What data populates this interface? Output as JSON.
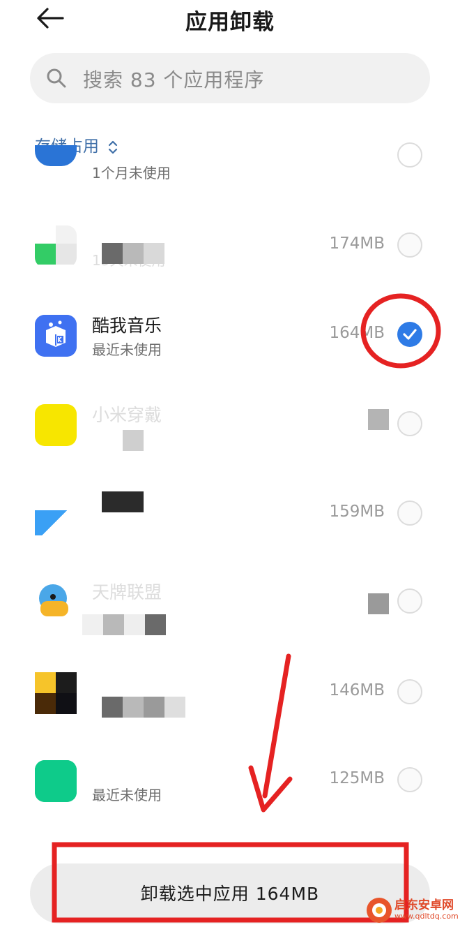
{
  "header": {
    "title": "应用卸载",
    "back_icon": "arrow-left-icon"
  },
  "search": {
    "placeholder": "搜索 83 个应用程序",
    "icon": "search-icon"
  },
  "sort": {
    "label": "存储占用",
    "icon": "chevron-updown-icon"
  },
  "apps": [
    {
      "name": "",
      "usage": "1个月未使用",
      "size": "",
      "selected": false
    },
    {
      "name": "",
      "usage": "15天未使用",
      "size": "174MB",
      "selected": false
    },
    {
      "name": "酷我音乐",
      "usage": "最近未使用",
      "size": "164MB",
      "selected": true
    },
    {
      "name": "小米穿戴",
      "usage": "",
      "size": "",
      "selected": false
    },
    {
      "name": "",
      "usage": "",
      "size": "159MB",
      "selected": false
    },
    {
      "name": "天牌联盟",
      "usage": "",
      "size": "",
      "selected": false
    },
    {
      "name": "",
      "usage": "",
      "size": "146MB",
      "selected": false
    },
    {
      "name": "",
      "usage": "最近未使用",
      "size": "125MB",
      "selected": false
    }
  ],
  "bottom": {
    "uninstall_label": "卸载选中应用 164MB"
  },
  "watermark": {
    "text": "启东安卓网",
    "url": "www.qdltdq.com"
  },
  "colors": {
    "accent": "#2e7be6",
    "annotation": "#e52222",
    "sort": "#3f6fa8"
  }
}
